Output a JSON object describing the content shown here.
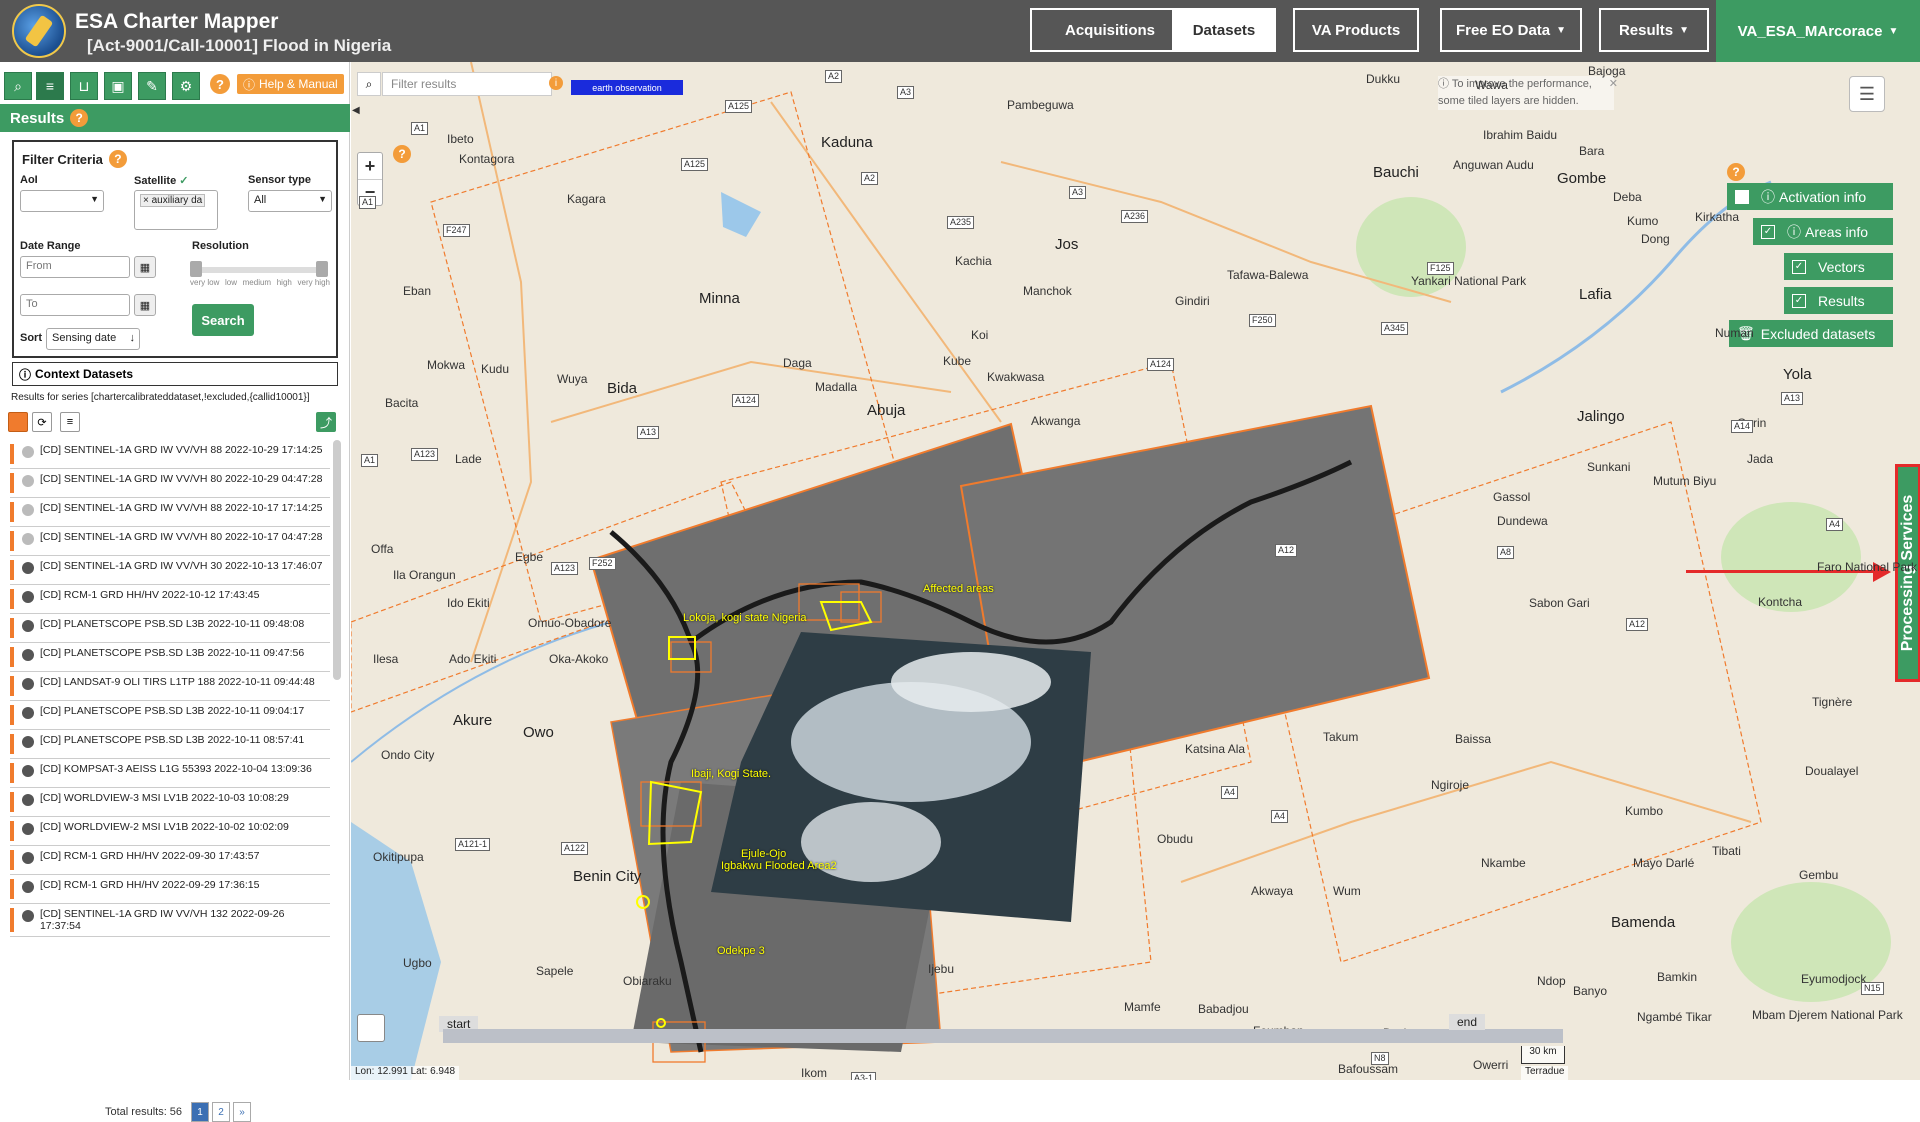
{
  "app": {
    "title": "ESA Charter Mapper",
    "activation": "[Act-9001/Call-10001] Flood in Nigeria"
  },
  "nav": {
    "acquisitions": "Acquisitions",
    "datasets": "Datasets",
    "va_products": "VA Products",
    "free_eo": "Free EO Data",
    "results": "Results",
    "user": "VA_ESA_MArcorace"
  },
  "left": {
    "help_manual": "Help & Manual",
    "results_title": "Results",
    "filter_title": "Filter Criteria",
    "aoi_label": "AoI",
    "satellite_label": "Satellite",
    "satellite_value": "× auxiliary da",
    "sensor_label": "Sensor type",
    "sensor_value": "All",
    "date_label": "Date Range",
    "from_placeholder": "From",
    "to_placeholder": "To",
    "resolution_label": "Resolution",
    "res_ticks": [
      "very low",
      "low",
      "medium",
      "high",
      "very high"
    ],
    "sort_label": "Sort",
    "sort_value": "Sensing date",
    "search": "Search",
    "context_title": "Context Datasets",
    "series_text": "Results for series [chartercalibrateddataset,!excluded,{callid10001}]",
    "items": [
      {
        "text": "[CD] SENTINEL-1A GRD IW VV/VH 88 2022-10-29 17:14:25",
        "bar": true,
        "light": true
      },
      {
        "text": "[CD] SENTINEL-1A GRD IW VV/VH 80 2022-10-29 04:47:28",
        "bar": true,
        "light": true
      },
      {
        "text": "[CD] SENTINEL-1A GRD IW VV/VH 88 2022-10-17 17:14:25",
        "bar": true,
        "light": true
      },
      {
        "text": "[CD] SENTINEL-1A GRD IW VV/VH 80 2022-10-17 04:47:28",
        "bar": true,
        "light": true
      },
      {
        "text": "[CD] SENTINEL-1A GRD IW VV/VH 30 2022-10-13 17:46:07",
        "bar": true,
        "light": false
      },
      {
        "text": "[CD] RCM-1 GRD HH/HV 2022-10-12 17:43:45",
        "bar": true,
        "light": false
      },
      {
        "text": "[CD] PLANETSCOPE PSB.SD L3B 2022-10-11 09:48:08",
        "bar": true,
        "light": false
      },
      {
        "text": "[CD] PLANETSCOPE PSB.SD L3B 2022-10-11 09:47:56",
        "bar": true,
        "light": false
      },
      {
        "text": "[CD] LANDSAT-9 OLI TIRS L1TP 188 2022-10-11 09:44:48",
        "bar": true,
        "light": false
      },
      {
        "text": "[CD] PLANETSCOPE PSB.SD L3B 2022-10-11 09:04:17",
        "bar": true,
        "light": false
      },
      {
        "text": "[CD] PLANETSCOPE PSB.SD L3B 2022-10-11 08:57:41",
        "bar": true,
        "light": false
      },
      {
        "text": "[CD] KOMPSAT-3 AEISS L1G 55393 2022-10-04 13:09:36",
        "bar": true,
        "light": false
      },
      {
        "text": "[CD] WORLDVIEW-3 MSI LV1B 2022-10-03 10:08:29",
        "bar": true,
        "light": false
      },
      {
        "text": "[CD] WORLDVIEW-2 MSI LV1B 2022-10-02 10:02:09",
        "bar": true,
        "light": false
      },
      {
        "text": "[CD] RCM-1 GRD HH/HV 2022-09-30 17:43:57",
        "bar": true,
        "light": false
      },
      {
        "text": "[CD] RCM-1 GRD HH/HV 2022-09-29 17:36:15",
        "bar": true,
        "light": false
      },
      {
        "text": "[CD] SENTINEL-1A GRD IW VV/VH 132 2022-09-26 17:37:54",
        "bar": true,
        "light": false
      }
    ],
    "total_results": "Total results: 56",
    "pages": [
      "1",
      "2",
      "»"
    ]
  },
  "map": {
    "filter_placeholder": "Filter results",
    "eo_tag": "earth observation",
    "perf_note": "To improve the performance, some tiled layers are hidden.",
    "layers": {
      "activation_info": "Activation info",
      "areas_info": "Areas info",
      "vectors": "Vectors",
      "results": "Results",
      "excluded": "Excluded datasets"
    },
    "processing_services": "Processing Services",
    "timeline_start": "start",
    "timeline_end": "end",
    "coords": "Lon: 12.991 Lat: 6.948",
    "scale": "30 km",
    "attribution": "Terradue",
    "aoi_labels": [
      "Affected areas",
      "Lokoja, kogi state Nigeria",
      "Ibaji, Kogi State.",
      "Ejule-Ojo",
      "Igbakwu Flooded Area2",
      "Odekpe 3"
    ],
    "places": [
      "Kaduna",
      "Pambeguwa",
      "Dukku",
      "Wawa",
      "Bajoga",
      "Ibrahim Baidu",
      "Bara",
      "Anguwan Audu",
      "Gombe",
      "Deba",
      "Ibeto",
      "Kontagora",
      "Kagara",
      "Bauchi",
      "Kumo",
      "Kirkatha",
      "Jos",
      "Dong",
      "Tafawa-Balewa",
      "Gindiri",
      "Manchok",
      "Kachia",
      "Minna",
      "Eban",
      "Lafia",
      "Numan",
      "Yankari National Park",
      "Mokwa",
      "Kudu",
      "Daga",
      "Kube",
      "Koi",
      "Kwakwasa",
      "Bacita",
      "Wuya",
      "Bida",
      "Madalla",
      "Abuja",
      "Akwanga",
      "Jalingo",
      "Gurin",
      "Yola",
      "Lade",
      "Sunkani",
      "Jada",
      "Mutum Biyu",
      "Gassol",
      "Dundewa",
      "Offa",
      "Ila Orangun",
      "Egbe",
      "Ido Ekiti",
      "Omuo-Obadore",
      "Ilesa",
      "Ado Ekiti",
      "Oka-Akoko",
      "Faro National Park",
      "Kontcha",
      "Sabon Gari",
      "Tignère",
      "Akure",
      "Owo",
      "Ondo City",
      "Katsina Ala",
      "Takum",
      "Baissa",
      "Ngiroje",
      "Doualayel",
      "Obudu",
      "Okitipupa",
      "Benin City",
      "Ugbo",
      "Sapele",
      "Obiaraku",
      "Akwaya",
      "Wum",
      "Nkambe",
      "Mayo Darlé",
      "Tibati",
      "Gembu",
      "Kumbo",
      "Bamenda",
      "Ndop",
      "Banyo",
      "Bamkin",
      "Ngambé Tikar",
      "Mbam Djerem National Park",
      "Eyumodjock",
      "Mamfe",
      "Babadjou",
      "Foumban",
      "Dschang",
      "Bafoussam",
      "Owerri",
      "Ikom",
      "Ijebu"
    ],
    "roads": [
      "A2",
      "A3",
      "A125",
      "A1",
      "A125",
      "A2",
      "A3",
      "A236",
      "A235",
      "A1",
      "F247",
      "F250",
      "A345",
      "F125",
      "A124",
      "A124",
      "A13",
      "A13",
      "A14",
      "A1",
      "A123",
      "A123",
      "F252",
      "A4",
      "A12",
      "A8",
      "A12",
      "A4",
      "A121-1",
      "A122",
      "A4",
      "N15",
      "N8",
      "A3-1"
    ]
  }
}
